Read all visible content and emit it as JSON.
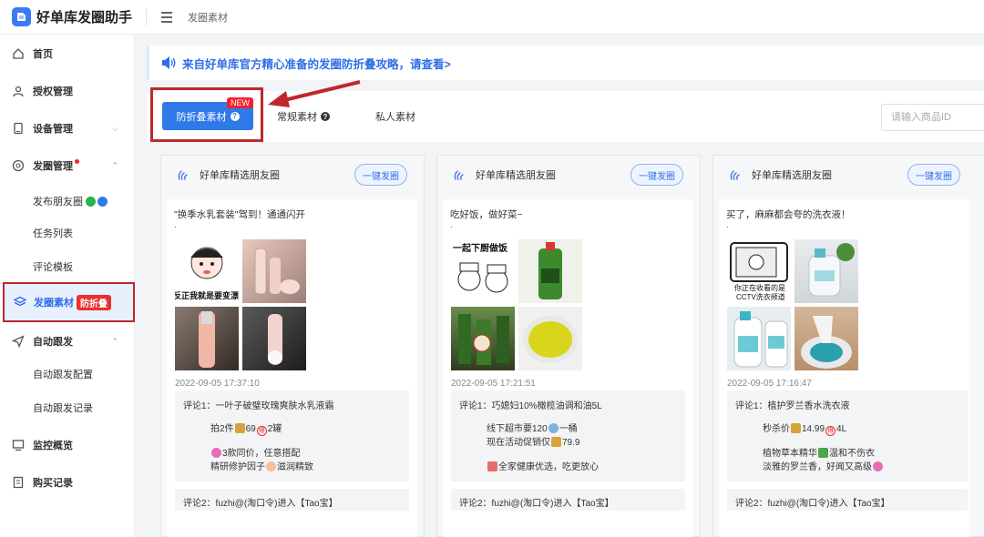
{
  "app": {
    "title": "好单库发圈助手",
    "breadcrumb": "发圈素材"
  },
  "sidebar": {
    "items": [
      {
        "label": "首页",
        "icon": "home-icon"
      },
      {
        "label": "授权管理",
        "icon": "user-icon"
      },
      {
        "label": "设备管理",
        "icon": "device-icon"
      },
      {
        "label": "发圈管理",
        "icon": "aperture-icon"
      },
      {
        "label": "发圈素材",
        "icon": "layers-icon",
        "badge": "防折叠"
      },
      {
        "label": "自动跟发",
        "icon": "send-icon"
      },
      {
        "label": "监控概览",
        "icon": "monitor-icon"
      },
      {
        "label": "购买记录",
        "icon": "receipt-icon"
      }
    ],
    "sub_publish": "发布朋友圈",
    "sub_tasks": "任务列表",
    "sub_comment": "评论模板",
    "sub_follow_config": "自动跟发配置",
    "sub_follow_log": "自动跟发记录"
  },
  "notice": {
    "text": "来自好单库官方精心准备的发圈防折叠攻略，请查看>"
  },
  "tabs": {
    "primary": "防折叠素材",
    "new_badge": "NEW",
    "regular": "常规素材",
    "private": "私人素材",
    "search_placeholder": "请输入商品ID"
  },
  "cards": [
    {
      "title": "好单库精选朋友圈",
      "share": "一键发圈",
      "text": "\"换季水乳套装\"驾到！通通闪开",
      "dot": ".",
      "time": "2022-09-05 17:37:10",
      "c1_title": "评论1：一叶子破璧玫瑰爽肤水乳液霜",
      "c1_l1a": "拍2件",
      "c1_l1b": "69",
      "c1_l1c": "得",
      "c1_l1d": "2罐",
      "c1_l2": "3款同价，任意搭配",
      "c1_l3a": "精研修护因子",
      "c1_l3b": "滋润精致",
      "c2": "评论2：fuzhi@(淘口令)进入【Tao宝】",
      "img_caption": "反正我就是要变漂亮"
    },
    {
      "title": "好单库精选朋友圈",
      "share": "一键发圈",
      "text": "吃好饭，做好菜~",
      "dot": ".",
      "time": "2022-09-05 17:21:51",
      "c1_title": "评论1：巧媳妇10%橄榄油调和油5L",
      "c1_l1a": "线下超市要120",
      "c1_l1b": "一桶",
      "c1_l2a": "现在活动促销仅",
      "c1_l2b": "79.9",
      "c1_l3": "全家健康优选，吃更放心",
      "c2": "评论2：fuzhi@(淘口令)进入【Tao宝】",
      "img_caption": "一起下厨做饭"
    },
    {
      "title": "好单库精选朋友圈",
      "share": "一键发圈",
      "text": "买了，麻麻都会夸的洗衣液！",
      "dot": ".",
      "time": "2022-09-05 17:16:47",
      "c1_title": "评论1：植护罗兰香水洗衣液",
      "c1_l1a": "秒杀价",
      "c1_l1b": "14.99",
      "c1_l1c": "得",
      "c1_l1d": "4L",
      "c1_l2a": "植物草本精华",
      "c1_l2b": "温和不伤衣",
      "c1_l3": "淡雅的罗兰香，好闻又高级",
      "c2": "评论2：fuzhi@(淘口令)进入【Tao宝】",
      "img_caption_1": "你正在收看的是",
      "img_caption_2": "CCTV洗衣频道"
    }
  ],
  "colors": {
    "primary": "#2f7ae8",
    "highlight_red": "#c0272d",
    "badge_red": "#e8312f"
  }
}
